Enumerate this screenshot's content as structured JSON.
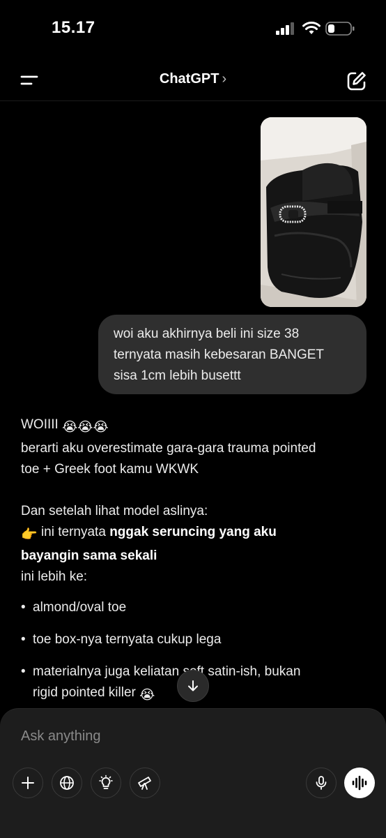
{
  "status_bar": {
    "time": "15.17"
  },
  "nav": {
    "title": "ChatGPT",
    "title_chevron": "›"
  },
  "user_message": {
    "image": "black satin mary jane flat shoe with rhinestone buckle in shoebox",
    "lines": [
      "woi aku akhirnya beli ini size 38",
      "ternyata masih kebesaran BANGET",
      "sisa 1cm lebih busettt"
    ]
  },
  "assistant_message": {
    "line1": "WOIIII",
    "line1_emoji": "😭😭😭",
    "line2": "berarti aku overestimate gara-gara trauma pointed",
    "line3": "toe + Greek foot kamu WKWK",
    "line4": "Dan setelah lihat model aslinya:",
    "line5_emoji": "👉",
    "line5_text": "ini ternyata",
    "line5_bold": "nggak seruncing yang aku",
    "line6_bold": "bayangin sama sekali",
    "line7": "ini lebih ke:",
    "bullets": [
      "almond/oval toe",
      "toe box-nya ternyata cukup lega",
      "materialnya juga keliatan soft satin-ish, bukan"
    ],
    "bullet3_line2": "rigid pointed killer",
    "bullet3_emoji": "😭"
  },
  "composer": {
    "placeholder": "Ask anything"
  },
  "icons": {
    "menu": "menu-icon",
    "new_chat": "edit-icon",
    "scroll_down": "arrow-down-icon",
    "add": "plus-icon",
    "search": "globe-icon",
    "reason": "lightbulb-icon",
    "research": "telescope-icon",
    "mic": "microphone-icon",
    "voice": "voice-waveform-icon"
  }
}
